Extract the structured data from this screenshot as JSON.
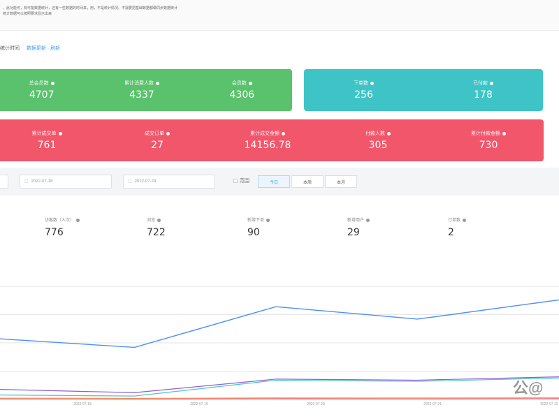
{
  "notice": {
    "lines": [
      "，此功能可，有可能数据统计，还有一些数据的时间来，用，不是统计情况。不需要把基础数据都做同步数据统计",
      "统计数据可以按照要求显示出来"
    ]
  },
  "subhead": {
    "label": "统计时间",
    "link": "数据更新 · 刷新"
  },
  "cards": {
    "green": [
      {
        "label": "总会员数",
        "value": "4707"
      },
      {
        "label": "累计消费人数",
        "value": "4337"
      },
      {
        "label": "会员数",
        "value": "4306"
      }
    ],
    "teal": [
      {
        "label": "下单数",
        "value": "256"
      },
      {
        "label": "已付款",
        "value": "178"
      }
    ],
    "red": [
      {
        "label": "累计成交单",
        "value": "761"
      },
      {
        "label": "成交订单",
        "value": "27"
      },
      {
        "label": "累计成交金额",
        "value": "14156.78"
      },
      {
        "label": "付款人数",
        "value": "305"
      },
      {
        "label": "累计付款金额",
        "value": "730"
      }
    ]
  },
  "filter": {
    "date_start": "2022-07-18",
    "date_end": "2022-07-24",
    "range_label": "范围",
    "segments": [
      "今日",
      "本周",
      "本月"
    ]
  },
  "metrics": [
    {
      "label": "访客数（人次）",
      "value": "776"
    },
    {
      "label": "浏览",
      "value": "722"
    },
    {
      "label": "新增下单",
      "value": "90"
    },
    {
      "label": "新增用户",
      "value": "29"
    },
    {
      "label": "订单数",
      "value": "2"
    }
  ],
  "chart_data": {
    "type": "line",
    "categories": [
      "2022-07-18",
      "2022-07-19",
      "2022-07-20",
      "2022-07-21",
      "2022-07-22"
    ],
    "series": [
      {
        "values": [
          540,
          460,
          820,
          710,
          880
        ],
        "color": "#4f8ef7"
      },
      {
        "values": [
          90,
          60,
          180,
          170,
          200
        ],
        "color": "#8e5ed8"
      },
      {
        "values": [
          40,
          30,
          170,
          160,
          190
        ],
        "color": "#4cc7c7"
      },
      {
        "values": [
          12,
          10,
          14,
          13,
          15
        ],
        "color": "#f3a15a"
      },
      {
        "values": [
          5,
          4,
          6,
          5,
          7
        ],
        "color": "#f25d6e"
      }
    ],
    "ylim": [
      0,
      1000
    ],
    "grid": true
  },
  "watermark": "公@"
}
